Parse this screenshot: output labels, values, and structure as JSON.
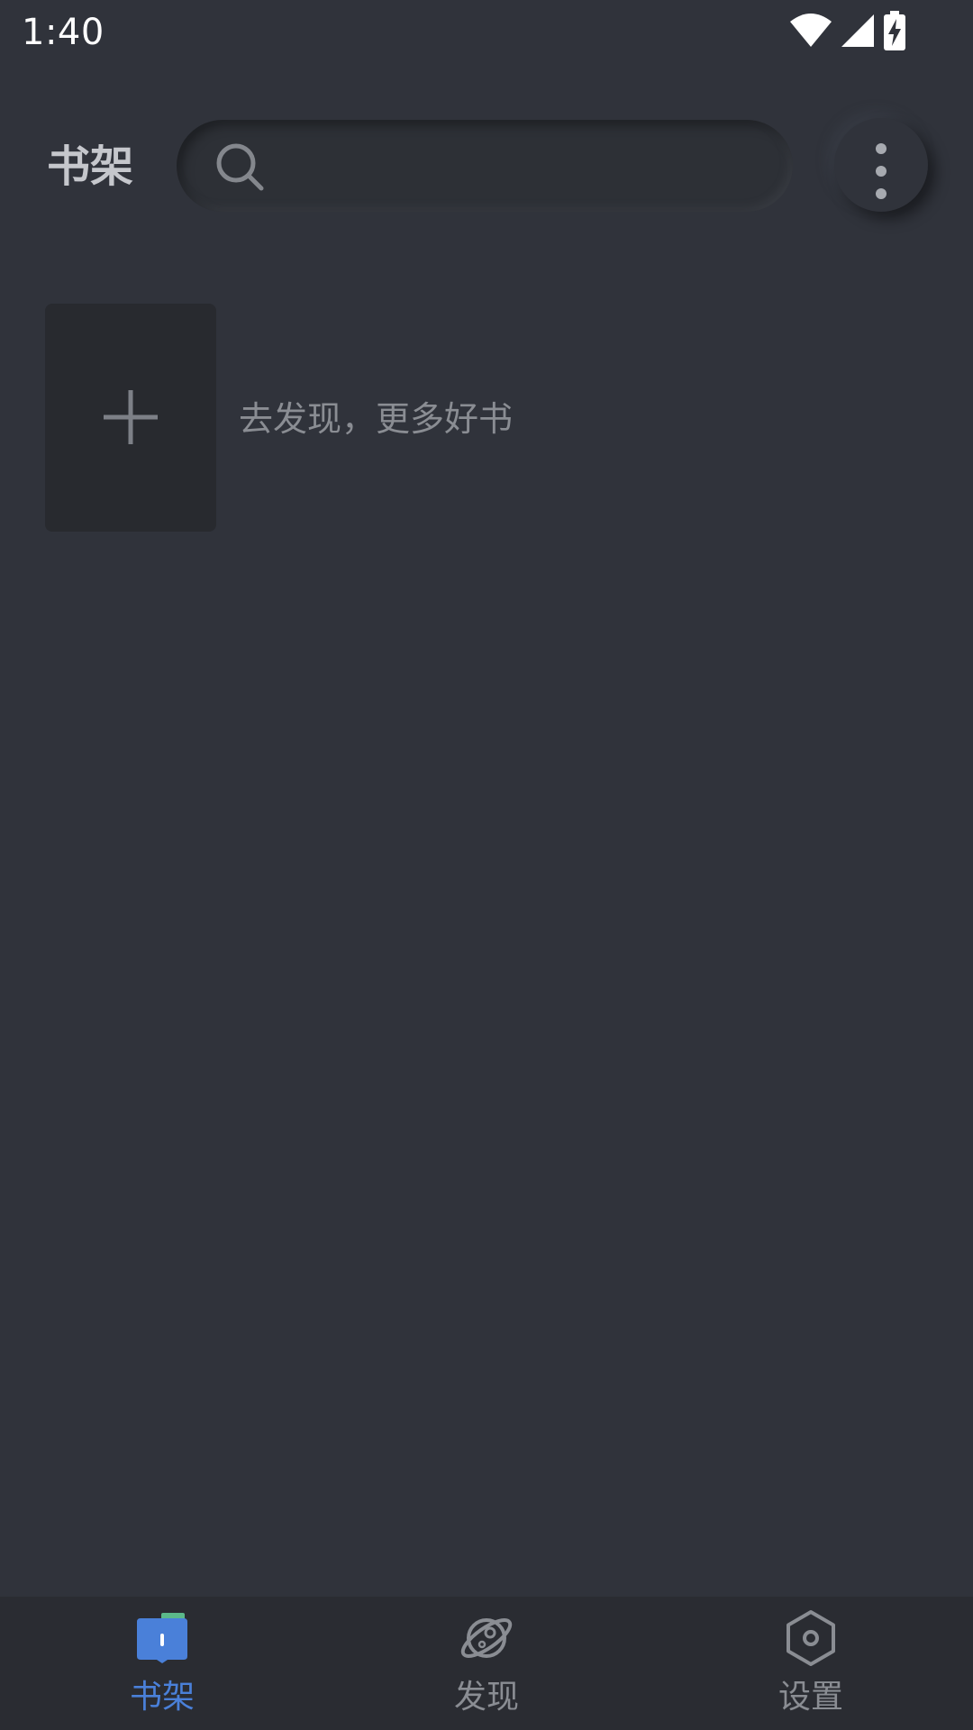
{
  "status_bar": {
    "time": "1:40",
    "icons": [
      "wifi-icon",
      "cell-signal-icon",
      "battery-charging-icon"
    ]
  },
  "header": {
    "title": "书架",
    "search": {
      "value": "",
      "placeholder": ""
    },
    "menu_icon": "more-vertical-icon"
  },
  "bookshelf": {
    "add_icon": "plus-icon",
    "discover_hint": "去发现，更多好书"
  },
  "bottom_nav": {
    "items": [
      {
        "label": "书架",
        "icon": "bookshelf-icon",
        "active": true
      },
      {
        "label": "发现",
        "icon": "planet-icon",
        "active": false
      },
      {
        "label": "设置",
        "icon": "hexagon-settings-icon",
        "active": false
      }
    ]
  },
  "colors": {
    "background": "#30333b",
    "nav_background": "#2a2c32",
    "accent": "#4a80d9",
    "inactive": "#8a8d93",
    "title": "#c5c7cc"
  }
}
